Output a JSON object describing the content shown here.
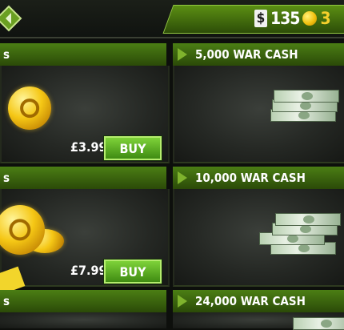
{
  "topbar": {
    "cash": "135",
    "gold": "3",
    "back_icon": "back-arrow-icon"
  },
  "rows": [
    {
      "left": {
        "header": "s",
        "price": "£3.99",
        "buy_label": "BUY"
      },
      "right": {
        "header": "5,000 WAR CASH"
      }
    },
    {
      "left": {
        "header": "s",
        "price": "£7.99",
        "buy_label": "BUY"
      },
      "right": {
        "header": "10,000 WAR CASH"
      }
    },
    {
      "left": {
        "header": "s"
      },
      "right": {
        "header": "24,000 WAR CASH"
      }
    }
  ],
  "colors": {
    "accent_green": "#5b8f13",
    "button_green": "#6cc22c",
    "gold": "#f6d02c"
  }
}
